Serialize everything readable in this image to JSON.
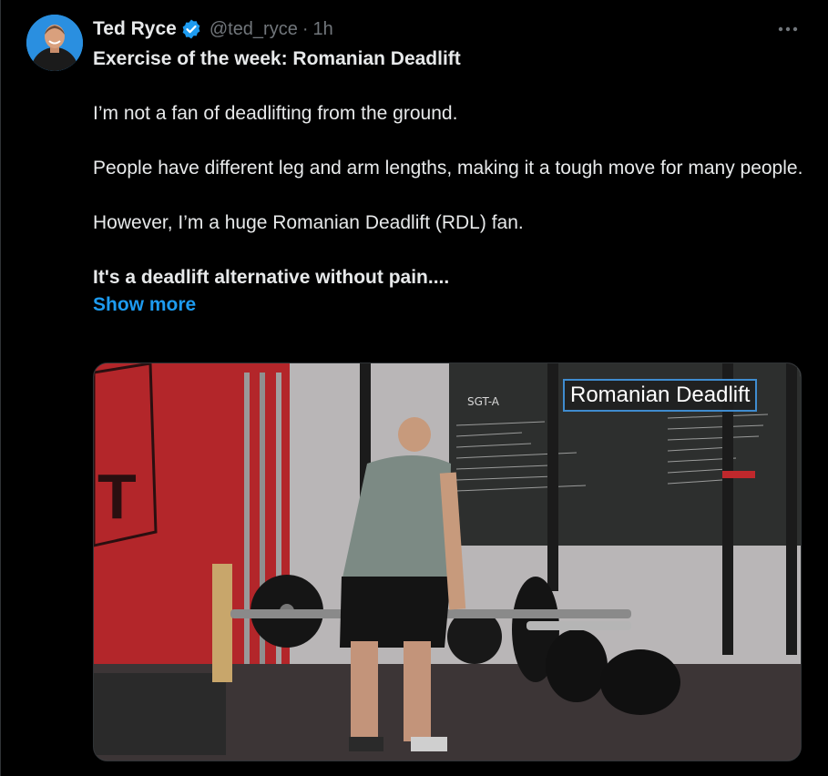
{
  "author": {
    "name": "Ted Ryce",
    "handle": "@ted_ryce",
    "separator": "·",
    "time": "1h",
    "verified": true,
    "avatar": "avatar-photo"
  },
  "tweet": {
    "headline": "Exercise of the week: Romanian Deadlift",
    "paragraphs": [
      "I’m not a fan of deadlifting from the ground.",
      "People have different leg and arm lengths, making it a tough move for many people.",
      "However, I’m a huge Romanian Deadlift (RDL) fan."
    ],
    "bold_line": "It's a deadlift alternative without pain....",
    "show_more": "Show more"
  },
  "media": {
    "overlay_label": "Romanian Deadlift",
    "whiteboard_title": "SGT-A"
  },
  "icons": {
    "verified": "verified-badge-icon",
    "more": "more-options-icon"
  },
  "colors": {
    "background": "#000000",
    "text": "#e7e9ea",
    "secondary_text": "#71767b",
    "accent": "#1d9bf0",
    "verified_badge": "#1d9bf0"
  }
}
